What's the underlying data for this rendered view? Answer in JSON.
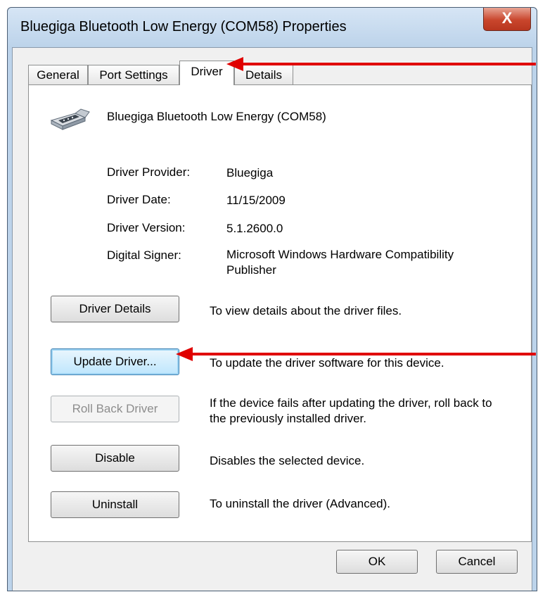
{
  "window": {
    "title": "Bluegiga Bluetooth Low Energy (COM58) Properties",
    "close_glyph": "X"
  },
  "tabs": [
    {
      "label": "General"
    },
    {
      "label": "Port Settings"
    },
    {
      "label": "Driver",
      "active": true
    },
    {
      "label": "Details"
    }
  ],
  "device": {
    "name": "Bluegiga Bluetooth Low Energy (COM58)",
    "icon": "serial-port-icon"
  },
  "info": {
    "provider_label": "Driver Provider:",
    "provider": "Bluegiga",
    "date_label": "Driver Date:",
    "date": "11/15/2009",
    "version_label": "Driver Version:",
    "version": "5.1.2600.0",
    "signer_label": "Digital Signer:",
    "signer": "Microsoft Windows Hardware Compatibility Publisher"
  },
  "actions": {
    "details_button": "Driver Details",
    "details_desc": "To view details about the driver files.",
    "update_button": "Update Driver...",
    "update_desc": "To update the driver software for this device.",
    "rollback_button": "Roll Back Driver",
    "rollback_desc": "If the device fails after updating the driver, roll back to the previously installed driver.",
    "disable_button": "Disable",
    "disable_desc": "Disables the selected device.",
    "uninstall_button": "Uninstall",
    "uninstall_desc": "To uninstall the driver (Advanced)."
  },
  "footer": {
    "ok_label": "OK",
    "cancel_label": "Cancel"
  },
  "annotation": {
    "arrow_color": "#e00000"
  }
}
